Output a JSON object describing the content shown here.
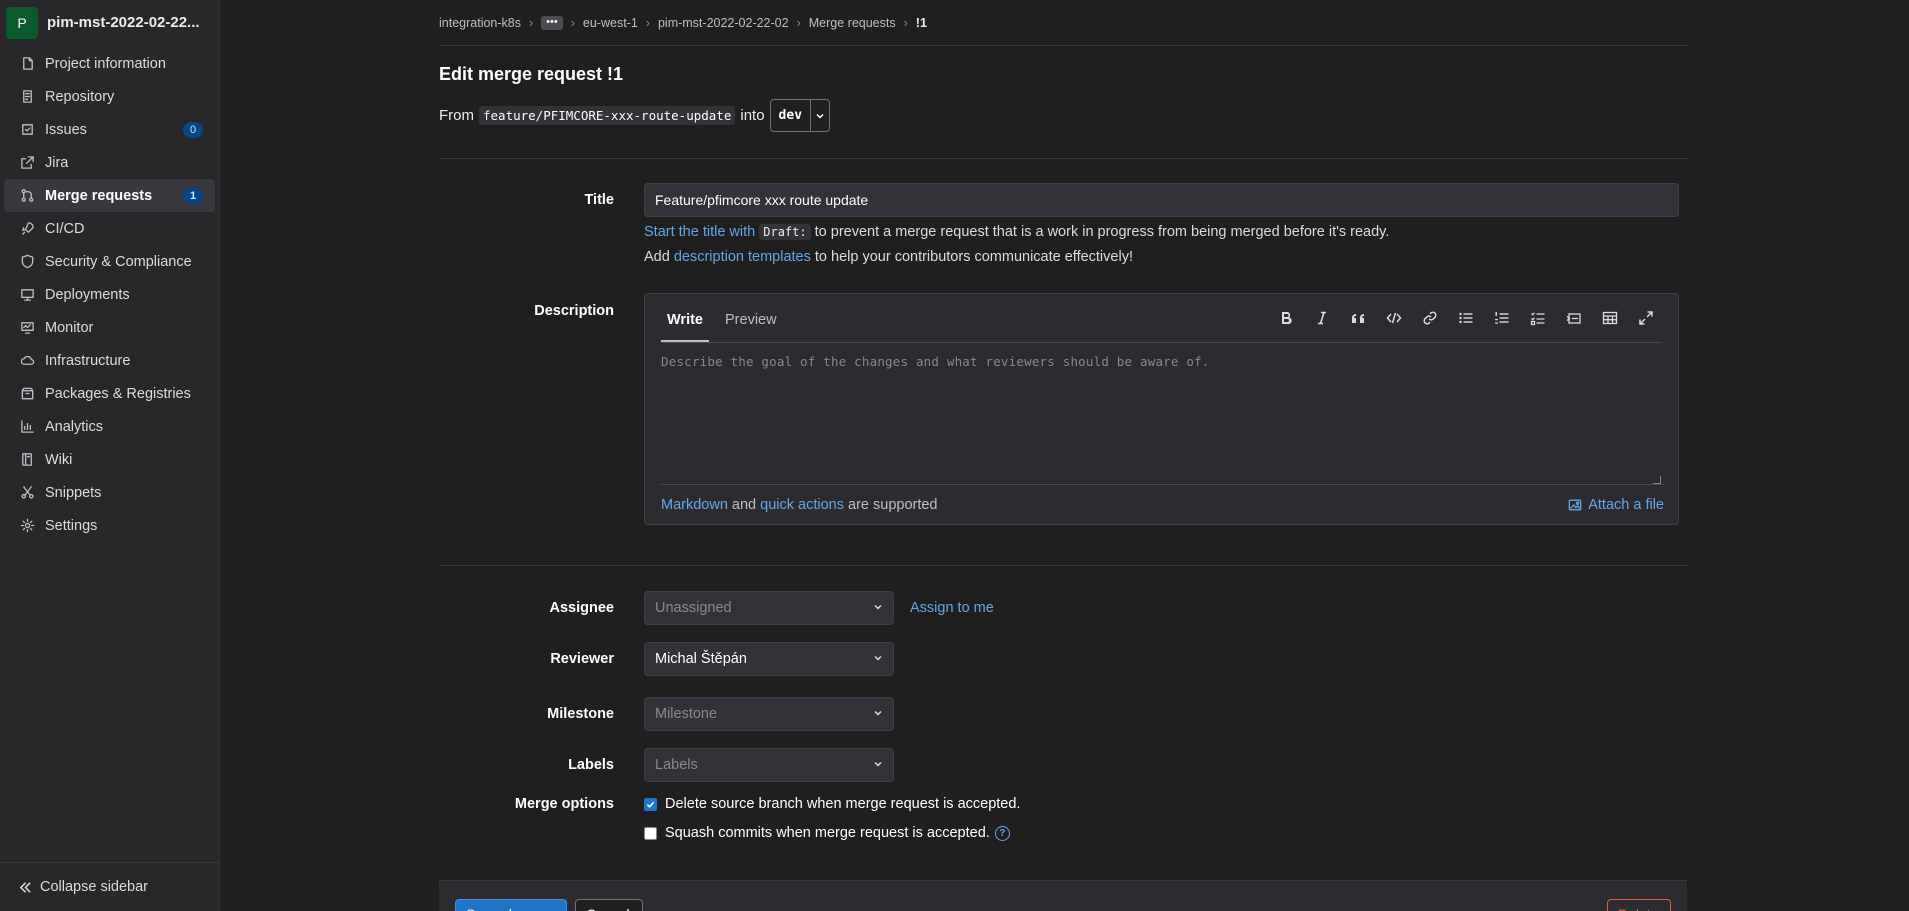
{
  "sidebar": {
    "avatar_letter": "P",
    "project_name": "pim-mst-2022-02-22...",
    "items": [
      {
        "label": "Project information",
        "icon": "project-icon"
      },
      {
        "label": "Repository",
        "icon": "repository-icon"
      },
      {
        "label": "Issues",
        "icon": "issues-icon",
        "badge": "0"
      },
      {
        "label": "Jira",
        "icon": "external-link-icon"
      },
      {
        "label": "Merge requests",
        "icon": "merge-request-icon",
        "badge": "1",
        "active": true
      },
      {
        "label": "CI/CD",
        "icon": "rocket-icon"
      },
      {
        "label": "Security & Compliance",
        "icon": "shield-icon"
      },
      {
        "label": "Deployments",
        "icon": "deployments-icon"
      },
      {
        "label": "Monitor",
        "icon": "monitor-icon"
      },
      {
        "label": "Infrastructure",
        "icon": "cloud-icon"
      },
      {
        "label": "Packages & Registries",
        "icon": "package-icon"
      },
      {
        "label": "Analytics",
        "icon": "chart-icon"
      },
      {
        "label": "Wiki",
        "icon": "book-icon"
      },
      {
        "label": "Snippets",
        "icon": "scissors-icon"
      },
      {
        "label": "Settings",
        "icon": "gear-icon"
      }
    ],
    "collapse_label": "Collapse sidebar"
  },
  "breadcrumb": {
    "items": [
      "integration-k8s",
      "eu-west-1",
      "pim-mst-2022-02-22-02",
      "Merge requests"
    ],
    "ellipsis": "•••",
    "current": "!1"
  },
  "page": {
    "title": "Edit merge request !1",
    "from_label": "From",
    "source_branch": "feature/PFIMCORE-xxx-route-update",
    "into_label": "into",
    "target_branch": "dev"
  },
  "form": {
    "title_label": "Title",
    "title_value": "Feature/pfimcore xxx route update",
    "draft_link": "Start the title with",
    "draft_code": "Draft:",
    "draft_rest": "to prevent a merge request that is a work in progress from being merged before it's ready.",
    "templates_pre": "Add",
    "templates_link": "description templates",
    "templates_post": "to help your contributors communicate effectively!",
    "description_label": "Description",
    "tab_write": "Write",
    "tab_preview": "Preview",
    "description_placeholder": "Describe the goal of the changes and what reviewers should be aware of.",
    "markdown_link": "Markdown",
    "and_text": "and",
    "quick_actions_link": "quick actions",
    "supported_text": "are supported",
    "attach_label": "Attach a file",
    "assignee_label": "Assignee",
    "assignee_value": "Unassigned",
    "assign_to_me": "Assign to me",
    "reviewer_label": "Reviewer",
    "reviewer_value": "Michal Štěpán",
    "milestone_label": "Milestone",
    "milestone_value": "Milestone",
    "labels_label": "Labels",
    "labels_value": "Labels",
    "merge_options_label": "Merge options",
    "delete_source_label": "Delete source branch when merge request is accepted.",
    "delete_source_checked": true,
    "squash_label": "Squash commits when merge request is accepted.",
    "squash_checked": false
  },
  "footer": {
    "save_label": "Save changes",
    "cancel_label": "Cancel",
    "delete_label": "Delete"
  },
  "colors": {
    "accent": "#1f75cb",
    "link": "#63a6e9",
    "danger": "#ec5941",
    "background": "#1f1f1f",
    "sidebar": "#28282b"
  }
}
